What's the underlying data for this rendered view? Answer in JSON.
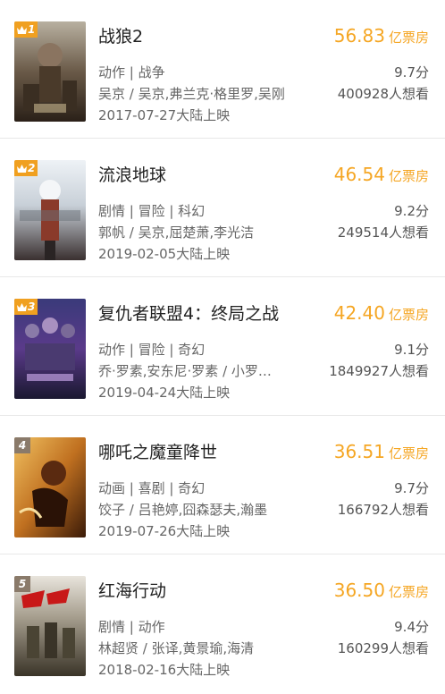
{
  "movies": [
    {
      "rank": "1",
      "title": "战狼2",
      "box_value": "56.83",
      "box_unit": "亿票房",
      "genre": "动作 | 战争",
      "cast": "吴京 / 吴京,弗兰克·格里罗,吴刚",
      "release": "2017-07-27大陆上映",
      "score": "9.7分",
      "wants": "400928人想看"
    },
    {
      "rank": "2",
      "title": "流浪地球",
      "box_value": "46.54",
      "box_unit": "亿票房",
      "genre": "剧情 | 冒险 | 科幻",
      "cast": "郭帆 / 吴京,屈楚萧,李光洁",
      "release": "2019-02-05大陆上映",
      "score": "9.2分",
      "wants": "249514人想看"
    },
    {
      "rank": "3",
      "title": "复仇者联盟4：终局之战",
      "box_value": "42.40",
      "box_unit": "亿票房",
      "genre": "动作 | 冒险 | 奇幻",
      "cast": "乔·罗素,安东尼·罗素 / 小罗…",
      "release": "2019-04-24大陆上映",
      "score": "9.1分",
      "wants": "1849927人想看"
    },
    {
      "rank": "4",
      "title": "哪吒之魔童降世",
      "box_value": "36.51",
      "box_unit": "亿票房",
      "genre": "动画 | 喜剧 | 奇幻",
      "cast": "饺子 / 吕艳婷,囧森瑟夫,瀚墨",
      "release": "2019-07-26大陆上映",
      "score": "9.7分",
      "wants": "166792人想看"
    },
    {
      "rank": "5",
      "title": "红海行动",
      "box_value": "36.50",
      "box_unit": "亿票房",
      "genre": "剧情 | 动作",
      "cast": "林超贤 / 张译,黄景瑜,海清",
      "release": "2018-02-16大陆上映",
      "score": "9.4分",
      "wants": "160299人想看"
    }
  ],
  "colors": {
    "accent": "#f5a623",
    "badge_top": "#f0a020",
    "badge_plain": "#8a7a6a",
    "divider": "#e8e8e8"
  }
}
